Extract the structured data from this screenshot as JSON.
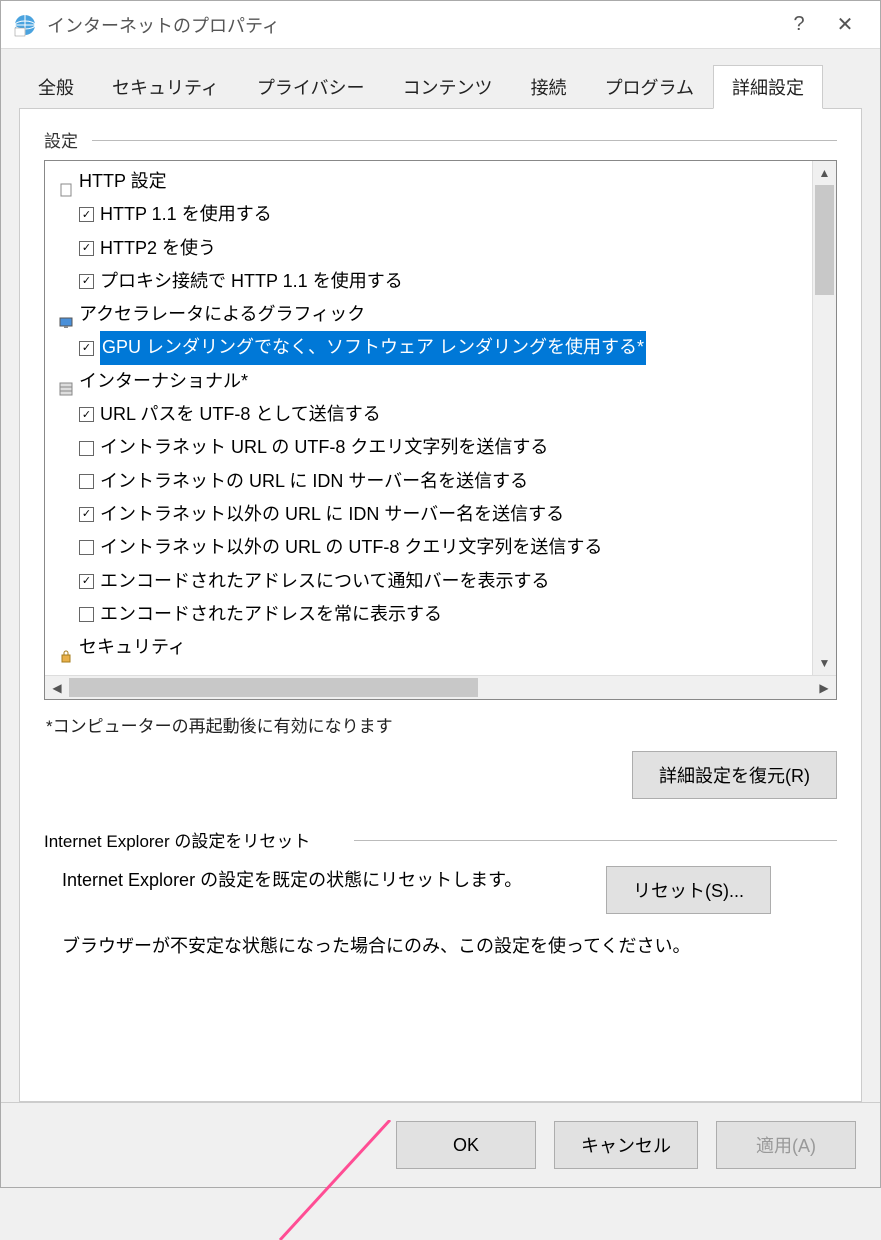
{
  "window": {
    "title": "インターネットのプロパティ",
    "help": "?",
    "close": "✕"
  },
  "tabs": [
    "全般",
    "セキュリティ",
    "プライバシー",
    "コンテンツ",
    "接続",
    "プログラム",
    "詳細設定"
  ],
  "activeTab": 6,
  "settingsLabel": "設定",
  "tree": [
    {
      "type": "cat",
      "icon": "page",
      "label": "HTTP 設定"
    },
    {
      "type": "item",
      "checked": true,
      "label": "HTTP 1.1 を使用する"
    },
    {
      "type": "item",
      "checked": true,
      "label": "HTTP2 を使う"
    },
    {
      "type": "item",
      "checked": true,
      "label": "プロキシ接続で HTTP 1.1 を使用する"
    },
    {
      "type": "cat",
      "icon": "monitor",
      "label": "アクセラレータによるグラフィック"
    },
    {
      "type": "item",
      "checked": true,
      "selected": true,
      "label": "GPU レンダリングでなく、ソフトウェア レンダリングを使用する*"
    },
    {
      "type": "cat",
      "icon": "globe",
      "label": "インターナショナル*"
    },
    {
      "type": "item",
      "checked": true,
      "label": "URL パスを UTF-8 として送信する"
    },
    {
      "type": "item",
      "checked": false,
      "label": "イントラネット URL の UTF-8 クエリ文字列を送信する"
    },
    {
      "type": "item",
      "checked": false,
      "label": "イントラネットの URL に IDN サーバー名を送信する"
    },
    {
      "type": "item",
      "checked": true,
      "label": "イントラネット以外の URL に IDN サーバー名を送信する"
    },
    {
      "type": "item",
      "checked": false,
      "label": "イントラネット以外の URL の UTF-8 クエリ文字列を送信する"
    },
    {
      "type": "item",
      "checked": true,
      "label": "エンコードされたアドレスについて通知バーを表示する"
    },
    {
      "type": "item",
      "checked": false,
      "label": "エンコードされたアドレスを常に表示する"
    },
    {
      "type": "cat",
      "icon": "lock",
      "label": "セキュリティ"
    }
  ],
  "restartNote": "*コンピューターの再起動後に有効になります",
  "restoreBtn": "詳細設定を復元(R)",
  "resetGroupLabel": "Internet Explorer の設定をリセット",
  "resetText": "Internet Explorer の設定を既定の状態にリセットします。",
  "resetBtn": "リセット(S)...",
  "warnText": "ブラウザーが不安定な状態になった場合にのみ、この設定を使ってください。",
  "footer": {
    "ok": "OK",
    "cancel": "キャンセル",
    "apply": "適用(A)"
  }
}
